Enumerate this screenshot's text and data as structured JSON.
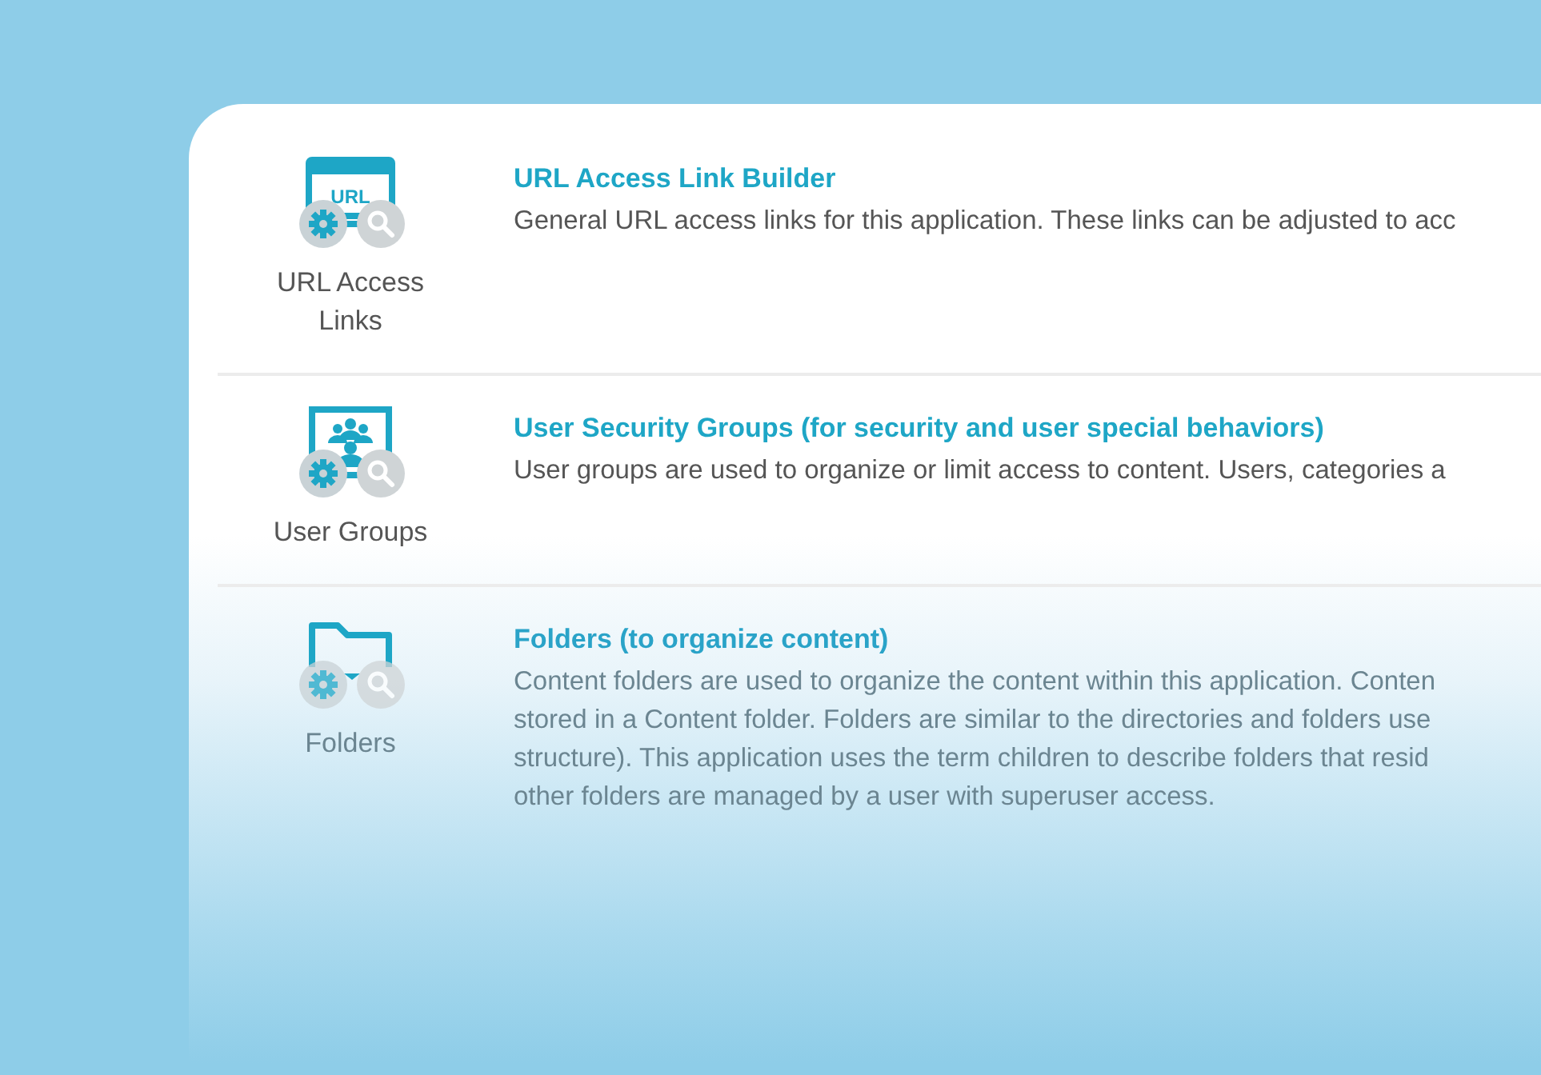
{
  "items": [
    {
      "kind": "url",
      "icon_text": "URL",
      "label": "URL Access Links",
      "title": "URL Access Link Builder",
      "description": [
        "General URL access links for this application. These links can be adjusted to acc"
      ]
    },
    {
      "kind": "users",
      "label": "User Groups",
      "title": "User Security Groups (for security and user special behaviors)",
      "description": [
        "User groups are used to organize or limit access to content. Users, categories a"
      ]
    },
    {
      "kind": "folder",
      "label": "Folders",
      "title": "Folders (to organize content)",
      "description": [
        "Content folders are used to organize the content within this application. Conten",
        "stored in a Content folder. Folders are similar to the directories and folders use",
        "structure). This application uses the term children to describe folders that resid",
        "other folders are managed by a user with superuser access."
      ]
    }
  ]
}
